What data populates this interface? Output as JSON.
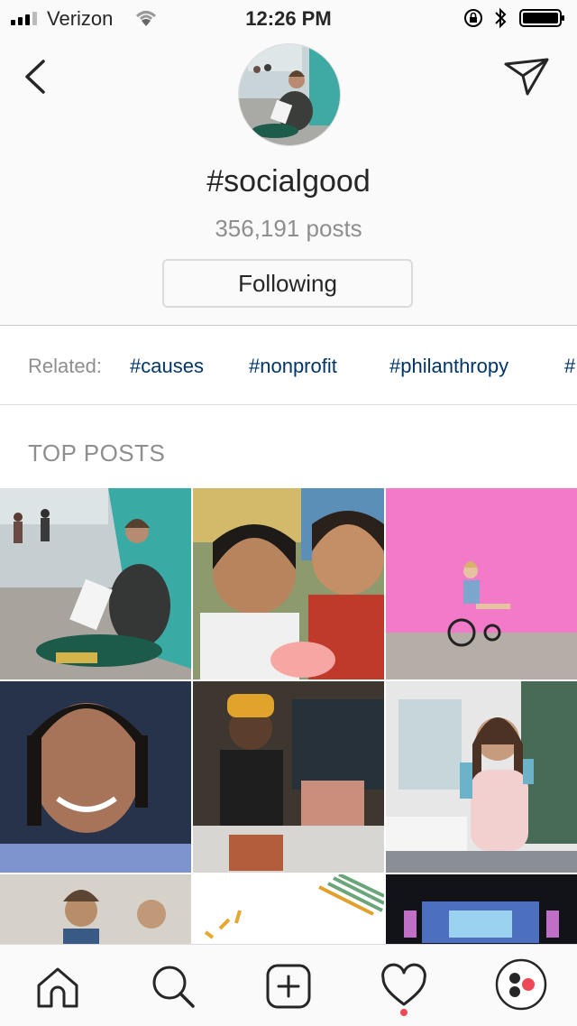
{
  "status_bar": {
    "carrier": "Verizon",
    "time": "12:26 PM"
  },
  "hashtag": {
    "title": "#socialgood",
    "post_count": "356,191 posts",
    "follow_label": "Following"
  },
  "related": {
    "label": "Related:",
    "tags": [
      "#causes",
      "#nonprofit",
      "#philanthropy",
      "#"
    ]
  },
  "top_posts": {
    "heading": "TOP POSTS"
  },
  "tab_bar": {
    "icons": [
      "home-icon",
      "search-icon",
      "add-post-icon",
      "activity-heart-icon",
      "profile-icon"
    ],
    "notification_color": "#ed4956"
  },
  "colors": {
    "link": "#003569",
    "muted": "#8e8e8e",
    "text": "#262626"
  }
}
